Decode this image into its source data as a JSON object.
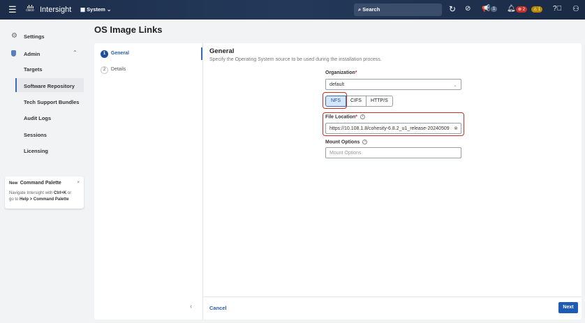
{
  "header": {
    "app_name": "Intersight",
    "logo_text": "cisco",
    "context": "System",
    "search_placeholder": "Search",
    "announcements_count": "1",
    "alerts_critical": "2",
    "alerts_warning": "1"
  },
  "sidebar": {
    "settings": "Settings",
    "admin": "Admin",
    "items": [
      {
        "label": "Targets"
      },
      {
        "label": "Software Repository"
      },
      {
        "label": "Tech Support Bundles"
      },
      {
        "label": "Audit Logs"
      },
      {
        "label": "Sessions"
      },
      {
        "label": "Licensing"
      }
    ],
    "palette": {
      "badge": "New",
      "title": "Command Palette",
      "close": "×",
      "line1_pre": "Navigate Intersight with ",
      "line1_key": "Ctrl+K",
      "line1_post": " or",
      "line2_pre": "go to ",
      "line2_path": "Help > Command Palette"
    }
  },
  "page": {
    "title": "OS Image Links"
  },
  "steps": [
    {
      "num": "1",
      "label": "General"
    },
    {
      "num": "2",
      "label": "Details"
    }
  ],
  "form": {
    "section_title": "General",
    "section_desc": "Specify the Operating System source to be used during the installation process.",
    "organization_label": "Organization",
    "organization_value": "default",
    "required": "*",
    "protocols": [
      "NFS",
      "CIFS",
      "HTTP/S"
    ],
    "selected_protocol": "NFS",
    "file_location_label": "File Location",
    "file_location_value": "https://10.108.1.8/cohesity-6.8.2_u1_release-20240509",
    "mount_options_label": "Mount Options",
    "mount_options_placeholder": "Mount Options"
  },
  "footer": {
    "cancel": "Cancel",
    "next": "Next",
    "collapse": "‹"
  }
}
